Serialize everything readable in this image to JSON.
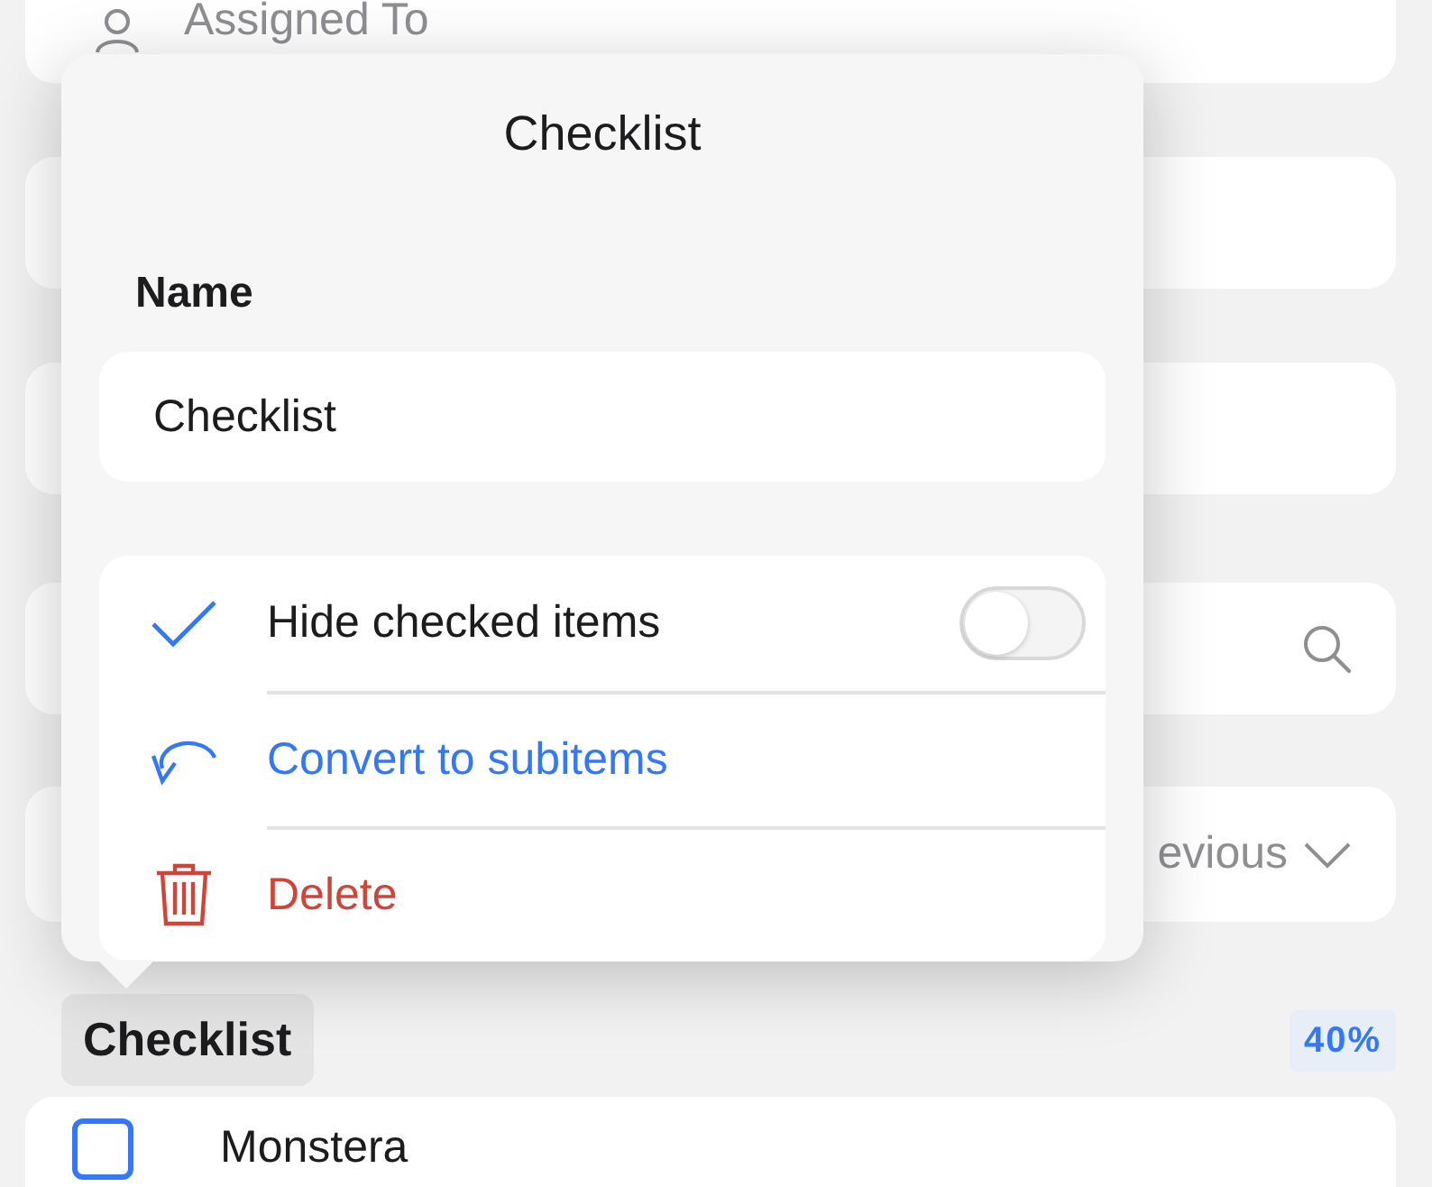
{
  "background": {
    "assignee_field": {
      "placeholder": "Assigned To"
    },
    "row_text": "evious",
    "checklist": {
      "title": "Checklist",
      "progress": "40%",
      "items": [
        {
          "label": "Monstera",
          "checked": false
        }
      ]
    }
  },
  "popover": {
    "title": "Checklist",
    "name_label": "Name",
    "name_value": "Checklist",
    "options": [
      {
        "kind": "toggle",
        "label": "Hide checked items",
        "on": false
      },
      {
        "kind": "convert",
        "label": "Convert to subitems"
      },
      {
        "kind": "delete",
        "label": "Delete"
      }
    ]
  }
}
